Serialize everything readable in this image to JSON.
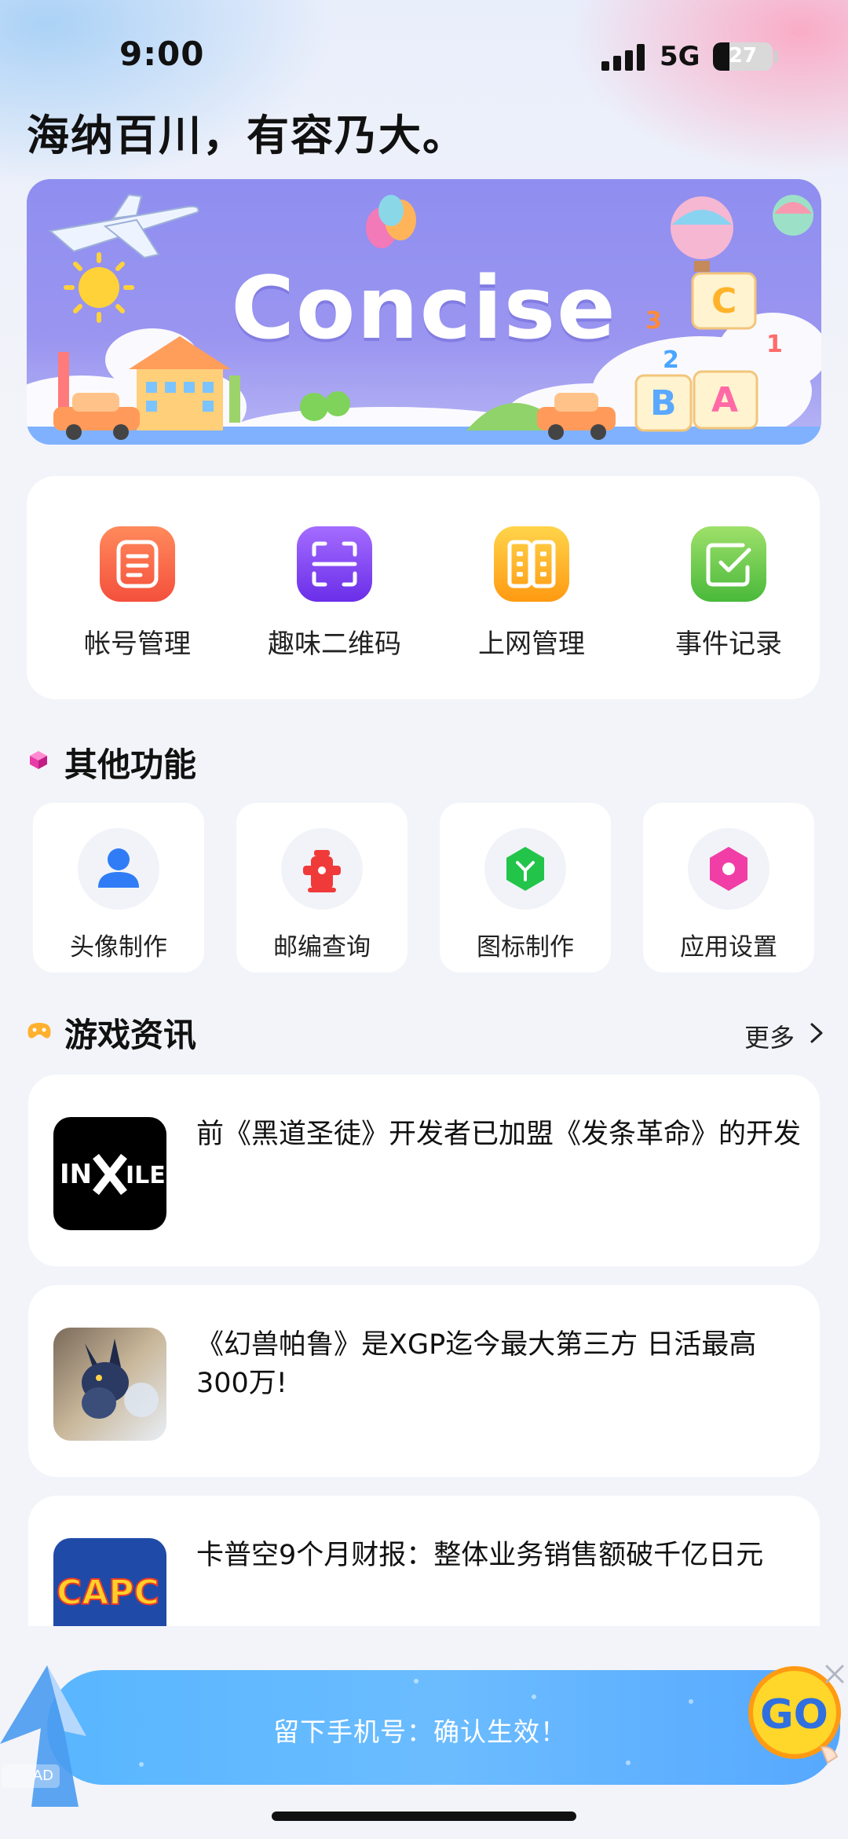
{
  "status_bar": {
    "time": "9:00",
    "network": "5G",
    "battery": "27",
    "battery_level": 0.27
  },
  "slogan": "海纳百川，有容乃大。",
  "banner": {
    "title": "Concise"
  },
  "quick_actions": [
    {
      "label": "帐号管理",
      "icon": "document-list-icon",
      "color_from": "#ff8a5c",
      "color_to": "#f4503c"
    },
    {
      "label": "趣味二维码",
      "icon": "qr-scan-icon",
      "color_from": "#a46cff",
      "color_to": "#6a2ee8"
    },
    {
      "label": "上网管理",
      "icon": "server-rack-icon",
      "color_from": "#ffd44a",
      "color_to": "#ff9a12"
    },
    {
      "label": "事件记录",
      "icon": "checkbox-icon",
      "color_from": "#9ee06a",
      "color_to": "#49b93a"
    }
  ],
  "other_functions": {
    "title": "其他功能",
    "items": [
      {
        "label": "头像制作",
        "icon": "user-icon",
        "color": "#2f7cf6"
      },
      {
        "label": "邮编查询",
        "icon": "hydrant-icon",
        "color": "#f03a3a"
      },
      {
        "label": "图标制作",
        "icon": "hexagon-y-icon",
        "color": "#22c44a"
      },
      {
        "label": "应用设置",
        "icon": "hexagon-settings-icon",
        "color": "#f03ea6"
      }
    ]
  },
  "game_news": {
    "title": "游戏资讯",
    "more": "更多",
    "items": [
      {
        "title": "前《黑道圣徒》开发者已加盟《发条革命》的开发",
        "thumb": "inxile-logo"
      },
      {
        "title": "《幻兽帕鲁》是XGP迄今最大第三方 日活最高300万!",
        "thumb": "palworld-image"
      },
      {
        "title": "卡普空9个月财报：整体业务销售额破千亿日元",
        "thumb": "capcom-logo"
      }
    ]
  },
  "ad": {
    "text": "留下手机号：确认生效！",
    "badge": "AD",
    "go": "GO"
  }
}
